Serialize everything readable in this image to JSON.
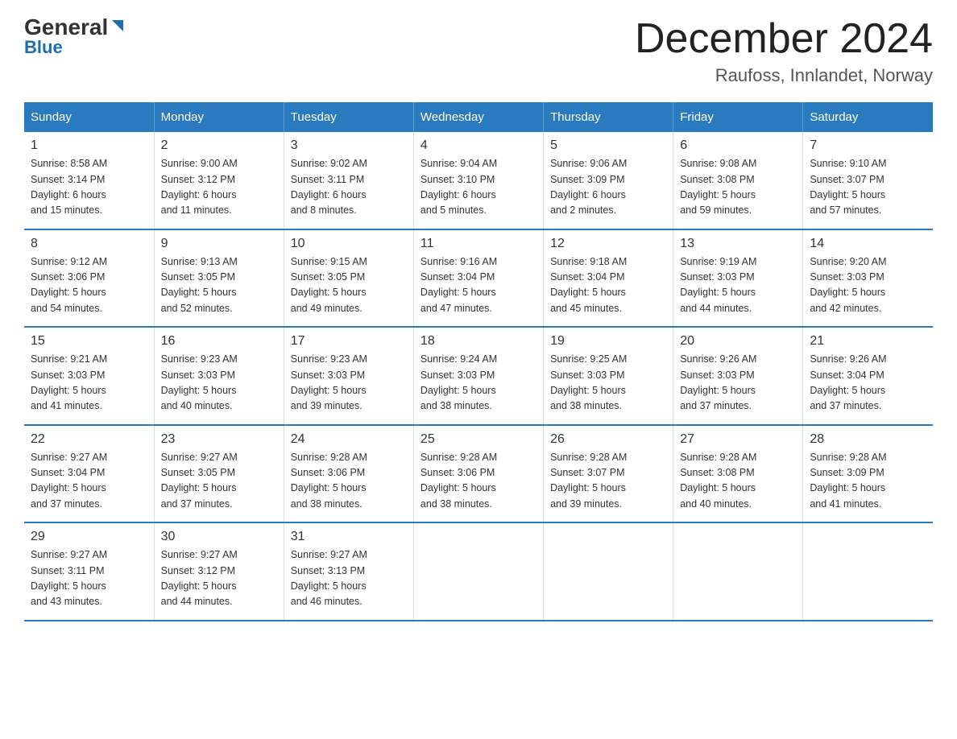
{
  "logo": {
    "general": "General",
    "blue": "Blue"
  },
  "title": {
    "month": "December 2024",
    "location": "Raufoss, Innlandet, Norway"
  },
  "headers": [
    "Sunday",
    "Monday",
    "Tuesday",
    "Wednesday",
    "Thursday",
    "Friday",
    "Saturday"
  ],
  "weeks": [
    [
      {
        "day": "1",
        "sunrise": "8:58 AM",
        "sunset": "3:14 PM",
        "daylight": "6 hours and 15 minutes."
      },
      {
        "day": "2",
        "sunrise": "9:00 AM",
        "sunset": "3:12 PM",
        "daylight": "6 hours and 11 minutes."
      },
      {
        "day": "3",
        "sunrise": "9:02 AM",
        "sunset": "3:11 PM",
        "daylight": "6 hours and 8 minutes."
      },
      {
        "day": "4",
        "sunrise": "9:04 AM",
        "sunset": "3:10 PM",
        "daylight": "6 hours and 5 minutes."
      },
      {
        "day": "5",
        "sunrise": "9:06 AM",
        "sunset": "3:09 PM",
        "daylight": "6 hours and 2 minutes."
      },
      {
        "day": "6",
        "sunrise": "9:08 AM",
        "sunset": "3:08 PM",
        "daylight": "5 hours and 59 minutes."
      },
      {
        "day": "7",
        "sunrise": "9:10 AM",
        "sunset": "3:07 PM",
        "daylight": "5 hours and 57 minutes."
      }
    ],
    [
      {
        "day": "8",
        "sunrise": "9:12 AM",
        "sunset": "3:06 PM",
        "daylight": "5 hours and 54 minutes."
      },
      {
        "day": "9",
        "sunrise": "9:13 AM",
        "sunset": "3:05 PM",
        "daylight": "5 hours and 52 minutes."
      },
      {
        "day": "10",
        "sunrise": "9:15 AM",
        "sunset": "3:05 PM",
        "daylight": "5 hours and 49 minutes."
      },
      {
        "day": "11",
        "sunrise": "9:16 AM",
        "sunset": "3:04 PM",
        "daylight": "5 hours and 47 minutes."
      },
      {
        "day": "12",
        "sunrise": "9:18 AM",
        "sunset": "3:04 PM",
        "daylight": "5 hours and 45 minutes."
      },
      {
        "day": "13",
        "sunrise": "9:19 AM",
        "sunset": "3:03 PM",
        "daylight": "5 hours and 44 minutes."
      },
      {
        "day": "14",
        "sunrise": "9:20 AM",
        "sunset": "3:03 PM",
        "daylight": "5 hours and 42 minutes."
      }
    ],
    [
      {
        "day": "15",
        "sunrise": "9:21 AM",
        "sunset": "3:03 PM",
        "daylight": "5 hours and 41 minutes."
      },
      {
        "day": "16",
        "sunrise": "9:23 AM",
        "sunset": "3:03 PM",
        "daylight": "5 hours and 40 minutes."
      },
      {
        "day": "17",
        "sunrise": "9:23 AM",
        "sunset": "3:03 PM",
        "daylight": "5 hours and 39 minutes."
      },
      {
        "day": "18",
        "sunrise": "9:24 AM",
        "sunset": "3:03 PM",
        "daylight": "5 hours and 38 minutes."
      },
      {
        "day": "19",
        "sunrise": "9:25 AM",
        "sunset": "3:03 PM",
        "daylight": "5 hours and 38 minutes."
      },
      {
        "day": "20",
        "sunrise": "9:26 AM",
        "sunset": "3:03 PM",
        "daylight": "5 hours and 37 minutes."
      },
      {
        "day": "21",
        "sunrise": "9:26 AM",
        "sunset": "3:04 PM",
        "daylight": "5 hours and 37 minutes."
      }
    ],
    [
      {
        "day": "22",
        "sunrise": "9:27 AM",
        "sunset": "3:04 PM",
        "daylight": "5 hours and 37 minutes."
      },
      {
        "day": "23",
        "sunrise": "9:27 AM",
        "sunset": "3:05 PM",
        "daylight": "5 hours and 37 minutes."
      },
      {
        "day": "24",
        "sunrise": "9:28 AM",
        "sunset": "3:06 PM",
        "daylight": "5 hours and 38 minutes."
      },
      {
        "day": "25",
        "sunrise": "9:28 AM",
        "sunset": "3:06 PM",
        "daylight": "5 hours and 38 minutes."
      },
      {
        "day": "26",
        "sunrise": "9:28 AM",
        "sunset": "3:07 PM",
        "daylight": "5 hours and 39 minutes."
      },
      {
        "day": "27",
        "sunrise": "9:28 AM",
        "sunset": "3:08 PM",
        "daylight": "5 hours and 40 minutes."
      },
      {
        "day": "28",
        "sunrise": "9:28 AM",
        "sunset": "3:09 PM",
        "daylight": "5 hours and 41 minutes."
      }
    ],
    [
      {
        "day": "29",
        "sunrise": "9:27 AM",
        "sunset": "3:11 PM",
        "daylight": "5 hours and 43 minutes."
      },
      {
        "day": "30",
        "sunrise": "9:27 AM",
        "sunset": "3:12 PM",
        "daylight": "5 hours and 44 minutes."
      },
      {
        "day": "31",
        "sunrise": "9:27 AM",
        "sunset": "3:13 PM",
        "daylight": "5 hours and 46 minutes."
      },
      null,
      null,
      null,
      null
    ]
  ]
}
